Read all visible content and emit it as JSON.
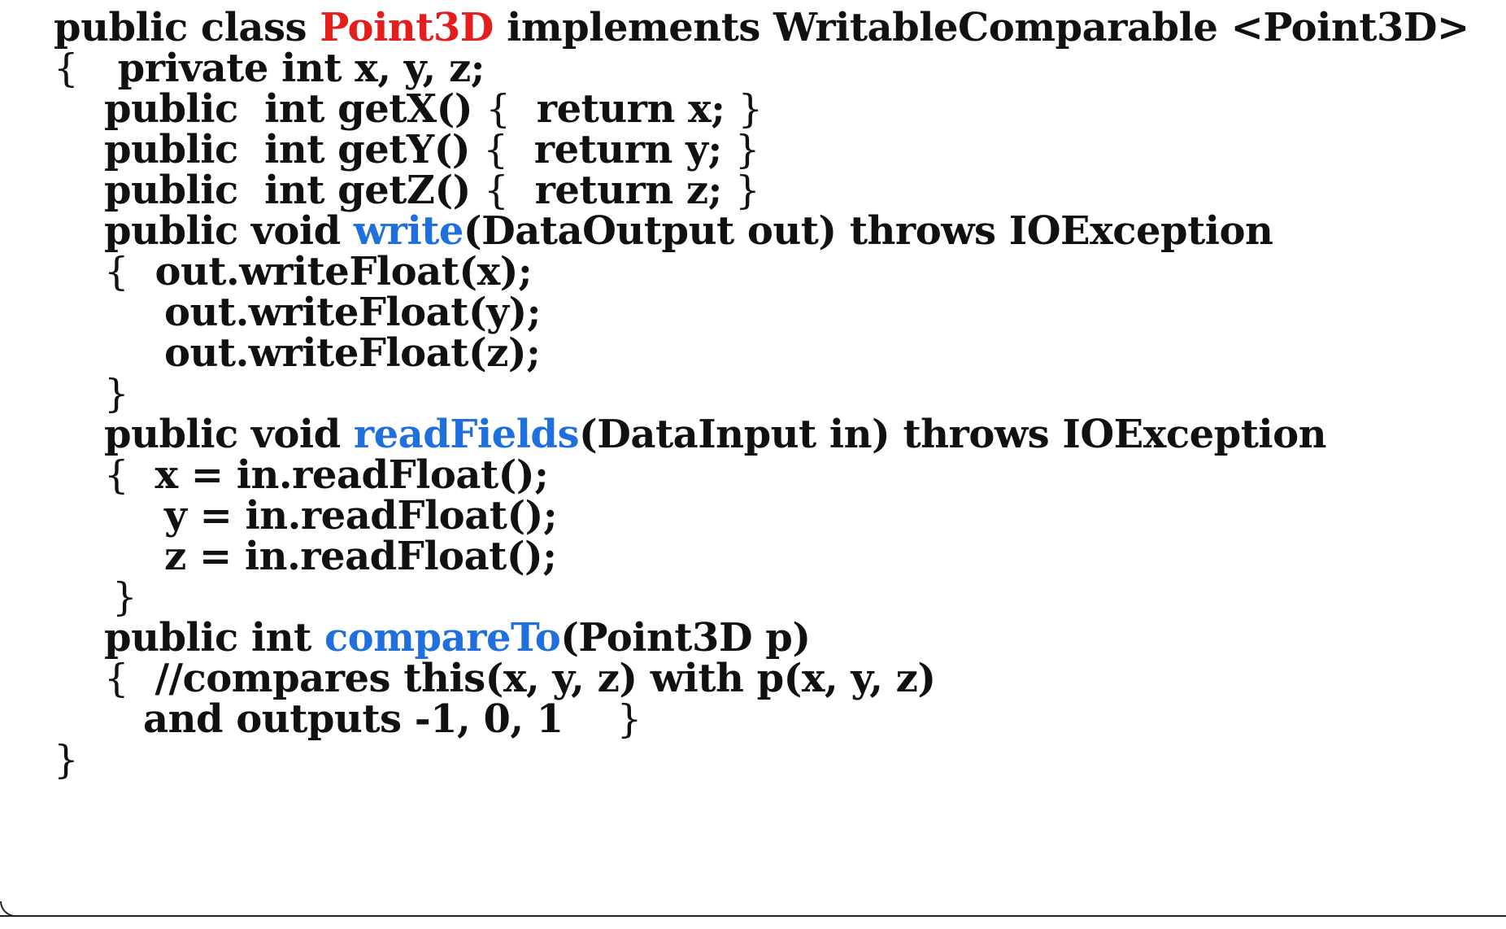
{
  "code": {
    "line1": {
      "prefix": "public class ",
      "class_name": "Point3D",
      "suffix": " implements WritableComparable <Point3D>"
    },
    "line2": {
      "open_brace": "{",
      "text": "   private int x, y, z;"
    },
    "line3": {
      "text": "public  int getX() ",
      "open_brace": "{",
      "body": "  return x; ",
      "close_brace": "}"
    },
    "line4": {
      "text": "public  int getY() ",
      "open_brace": "{",
      "body": "  return y; ",
      "close_brace": "}"
    },
    "line5": {
      "text": "public  int getZ() ",
      "open_brace": "{",
      "body": "  return z; ",
      "close_brace": "}"
    },
    "line6": {
      "prefix": "public void ",
      "method": "write",
      "suffix": "(DataOutput out) throws IOException"
    },
    "line7": {
      "open_brace": "{",
      "text": "  out.writeFloat(x);"
    },
    "line8": {
      "text": "out.writeFloat(y);"
    },
    "line9": {
      "text": "out.writeFloat(z);"
    },
    "line10": {
      "close_brace": "}"
    },
    "line11": {
      "prefix": "public void ",
      "method": "readFields",
      "suffix": "(DataInput in) throws IOException"
    },
    "line12": {
      "open_brace": "{",
      "text": "  x = in.readFloat();"
    },
    "line13": {
      "text": "y = in.readFloat();"
    },
    "line14": {
      "text": "z = in.readFloat();"
    },
    "line15": {
      "close_brace": "}"
    },
    "line16": {
      "prefix": "public int ",
      "method": "compareTo",
      "suffix": "(Point3D p)"
    },
    "line17": {
      "open_brace": "{",
      "text": "  //compares this(x, y, z) with p(x, y, z)"
    },
    "line18": {
      "text": "and outputs -1, 0, 1",
      "close_brace": "}"
    },
    "line19": {
      "close_brace": "}"
    }
  },
  "colors": {
    "text": "#111111",
    "class_name": "#e41d1d",
    "method_name": "#1f6fdc"
  }
}
